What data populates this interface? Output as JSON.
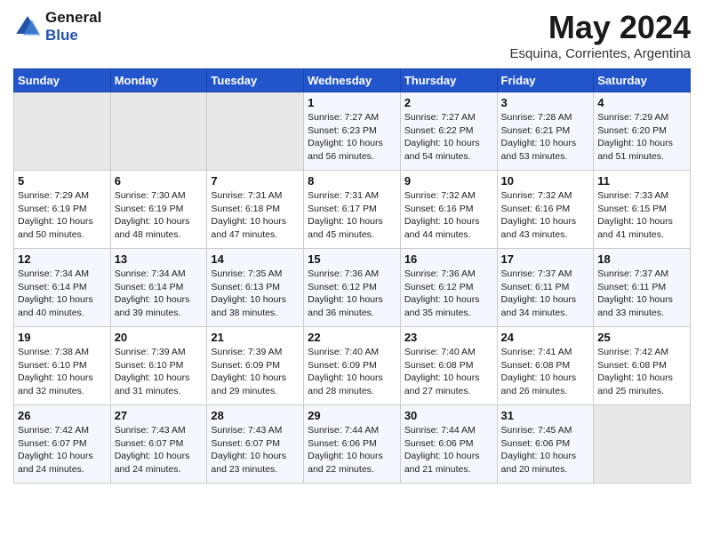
{
  "header": {
    "logo_line1": "General",
    "logo_line2": "Blue",
    "month_title": "May 2024",
    "location": "Esquina, Corrientes, Argentina"
  },
  "days_of_week": [
    "Sunday",
    "Monday",
    "Tuesday",
    "Wednesday",
    "Thursday",
    "Friday",
    "Saturday"
  ],
  "weeks": [
    [
      {
        "day": "",
        "sunrise": "",
        "sunset": "",
        "daylight": "",
        "empty": true
      },
      {
        "day": "",
        "sunrise": "",
        "sunset": "",
        "daylight": "",
        "empty": true
      },
      {
        "day": "",
        "sunrise": "",
        "sunset": "",
        "daylight": "",
        "empty": true
      },
      {
        "day": "1",
        "sunrise": "Sunrise: 7:27 AM",
        "sunset": "Sunset: 6:23 PM",
        "daylight": "Daylight: 10 hours and 56 minutes."
      },
      {
        "day": "2",
        "sunrise": "Sunrise: 7:27 AM",
        "sunset": "Sunset: 6:22 PM",
        "daylight": "Daylight: 10 hours and 54 minutes."
      },
      {
        "day": "3",
        "sunrise": "Sunrise: 7:28 AM",
        "sunset": "Sunset: 6:21 PM",
        "daylight": "Daylight: 10 hours and 53 minutes."
      },
      {
        "day": "4",
        "sunrise": "Sunrise: 7:29 AM",
        "sunset": "Sunset: 6:20 PM",
        "daylight": "Daylight: 10 hours and 51 minutes."
      }
    ],
    [
      {
        "day": "5",
        "sunrise": "Sunrise: 7:29 AM",
        "sunset": "Sunset: 6:19 PM",
        "daylight": "Daylight: 10 hours and 50 minutes."
      },
      {
        "day": "6",
        "sunrise": "Sunrise: 7:30 AM",
        "sunset": "Sunset: 6:19 PM",
        "daylight": "Daylight: 10 hours and 48 minutes."
      },
      {
        "day": "7",
        "sunrise": "Sunrise: 7:31 AM",
        "sunset": "Sunset: 6:18 PM",
        "daylight": "Daylight: 10 hours and 47 minutes."
      },
      {
        "day": "8",
        "sunrise": "Sunrise: 7:31 AM",
        "sunset": "Sunset: 6:17 PM",
        "daylight": "Daylight: 10 hours and 45 minutes."
      },
      {
        "day": "9",
        "sunrise": "Sunrise: 7:32 AM",
        "sunset": "Sunset: 6:16 PM",
        "daylight": "Daylight: 10 hours and 44 minutes."
      },
      {
        "day": "10",
        "sunrise": "Sunrise: 7:32 AM",
        "sunset": "Sunset: 6:16 PM",
        "daylight": "Daylight: 10 hours and 43 minutes."
      },
      {
        "day": "11",
        "sunrise": "Sunrise: 7:33 AM",
        "sunset": "Sunset: 6:15 PM",
        "daylight": "Daylight: 10 hours and 41 minutes."
      }
    ],
    [
      {
        "day": "12",
        "sunrise": "Sunrise: 7:34 AM",
        "sunset": "Sunset: 6:14 PM",
        "daylight": "Daylight: 10 hours and 40 minutes."
      },
      {
        "day": "13",
        "sunrise": "Sunrise: 7:34 AM",
        "sunset": "Sunset: 6:14 PM",
        "daylight": "Daylight: 10 hours and 39 minutes."
      },
      {
        "day": "14",
        "sunrise": "Sunrise: 7:35 AM",
        "sunset": "Sunset: 6:13 PM",
        "daylight": "Daylight: 10 hours and 38 minutes."
      },
      {
        "day": "15",
        "sunrise": "Sunrise: 7:36 AM",
        "sunset": "Sunset: 6:12 PM",
        "daylight": "Daylight: 10 hours and 36 minutes."
      },
      {
        "day": "16",
        "sunrise": "Sunrise: 7:36 AM",
        "sunset": "Sunset: 6:12 PM",
        "daylight": "Daylight: 10 hours and 35 minutes."
      },
      {
        "day": "17",
        "sunrise": "Sunrise: 7:37 AM",
        "sunset": "Sunset: 6:11 PM",
        "daylight": "Daylight: 10 hours and 34 minutes."
      },
      {
        "day": "18",
        "sunrise": "Sunrise: 7:37 AM",
        "sunset": "Sunset: 6:11 PM",
        "daylight": "Daylight: 10 hours and 33 minutes."
      }
    ],
    [
      {
        "day": "19",
        "sunrise": "Sunrise: 7:38 AM",
        "sunset": "Sunset: 6:10 PM",
        "daylight": "Daylight: 10 hours and 32 minutes."
      },
      {
        "day": "20",
        "sunrise": "Sunrise: 7:39 AM",
        "sunset": "Sunset: 6:10 PM",
        "daylight": "Daylight: 10 hours and 31 minutes."
      },
      {
        "day": "21",
        "sunrise": "Sunrise: 7:39 AM",
        "sunset": "Sunset: 6:09 PM",
        "daylight": "Daylight: 10 hours and 29 minutes."
      },
      {
        "day": "22",
        "sunrise": "Sunrise: 7:40 AM",
        "sunset": "Sunset: 6:09 PM",
        "daylight": "Daylight: 10 hours and 28 minutes."
      },
      {
        "day": "23",
        "sunrise": "Sunrise: 7:40 AM",
        "sunset": "Sunset: 6:08 PM",
        "daylight": "Daylight: 10 hours and 27 minutes."
      },
      {
        "day": "24",
        "sunrise": "Sunrise: 7:41 AM",
        "sunset": "Sunset: 6:08 PM",
        "daylight": "Daylight: 10 hours and 26 minutes."
      },
      {
        "day": "25",
        "sunrise": "Sunrise: 7:42 AM",
        "sunset": "Sunset: 6:08 PM",
        "daylight": "Daylight: 10 hours and 25 minutes."
      }
    ],
    [
      {
        "day": "26",
        "sunrise": "Sunrise: 7:42 AM",
        "sunset": "Sunset: 6:07 PM",
        "daylight": "Daylight: 10 hours and 24 minutes."
      },
      {
        "day": "27",
        "sunrise": "Sunrise: 7:43 AM",
        "sunset": "Sunset: 6:07 PM",
        "daylight": "Daylight: 10 hours and 24 minutes."
      },
      {
        "day": "28",
        "sunrise": "Sunrise: 7:43 AM",
        "sunset": "Sunset: 6:07 PM",
        "daylight": "Daylight: 10 hours and 23 minutes."
      },
      {
        "day": "29",
        "sunrise": "Sunrise: 7:44 AM",
        "sunset": "Sunset: 6:06 PM",
        "daylight": "Daylight: 10 hours and 22 minutes."
      },
      {
        "day": "30",
        "sunrise": "Sunrise: 7:44 AM",
        "sunset": "Sunset: 6:06 PM",
        "daylight": "Daylight: 10 hours and 21 minutes."
      },
      {
        "day": "31",
        "sunrise": "Sunrise: 7:45 AM",
        "sunset": "Sunset: 6:06 PM",
        "daylight": "Daylight: 10 hours and 20 minutes."
      },
      {
        "day": "",
        "sunrise": "",
        "sunset": "",
        "daylight": "",
        "empty": true
      }
    ]
  ]
}
